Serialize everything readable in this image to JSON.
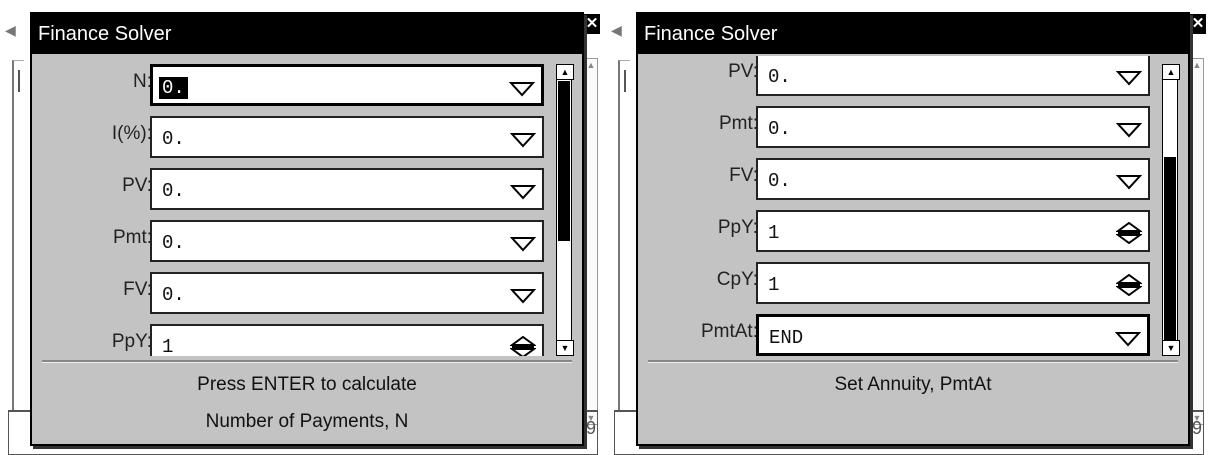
{
  "panels": [
    {
      "title": "Finance Solver",
      "fields": [
        {
          "label": "N:",
          "value": "0.",
          "control": "dropdown",
          "selected": true
        },
        {
          "label": "I(%):",
          "value": "0.",
          "control": "dropdown"
        },
        {
          "label": "PV:",
          "value": "0.",
          "control": "dropdown"
        },
        {
          "label": "Pmt:",
          "value": "0.",
          "control": "dropdown"
        },
        {
          "label": "FV:",
          "value": "0.",
          "control": "dropdown"
        },
        {
          "label": "PpY:",
          "value": "1",
          "control": "spinner"
        }
      ],
      "status_line1": "Press ENTER to calculate",
      "status_line2": "Number of Payments, N",
      "scroll_position": "top",
      "bg_number": "9"
    },
    {
      "title": "Finance Solver",
      "fields": [
        {
          "label": "PV:",
          "value": "0.",
          "control": "dropdown"
        },
        {
          "label": "Pmt:",
          "value": "0.",
          "control": "dropdown"
        },
        {
          "label": "FV:",
          "value": "0.",
          "control": "dropdown"
        },
        {
          "label": "PpY:",
          "value": "1",
          "control": "spinner"
        },
        {
          "label": "CpY:",
          "value": "1",
          "control": "spinner"
        },
        {
          "label": "PmtAt:",
          "value": "END",
          "control": "dropdown",
          "focused": true
        }
      ],
      "status_line1": "Set Annuity, PmtAt",
      "status_line2": "",
      "scroll_position": "bottom",
      "bg_number": "9"
    }
  ],
  "close_glyph": "✕"
}
